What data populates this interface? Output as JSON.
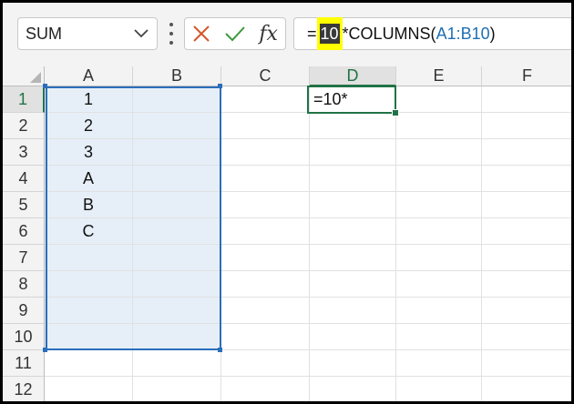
{
  "name_box": {
    "value": "SUM"
  },
  "formula_bar": {
    "prefix": "=",
    "highlighted": "10",
    "middle": "*COLUMNS(",
    "ref": "A1:B10",
    "suffix": ")"
  },
  "columns": [
    "A",
    "B",
    "C",
    "D",
    "E",
    "F"
  ],
  "rows": [
    "1",
    "2",
    "3",
    "4",
    "5",
    "6",
    "7",
    "8",
    "9",
    "10",
    "11",
    "12"
  ],
  "cells": {
    "A1": "1",
    "A2": "2",
    "A3": "3",
    "A4": "A",
    "A5": "B",
    "A6": "C",
    "D1": "=10*"
  },
  "selected_range": "A1:B10",
  "active_cell": "D1",
  "colors": {
    "range_border": "#2a6ebb",
    "range_fill": "#e6eff8",
    "active_green": "#217346",
    "highlight_yellow": "#ffff00",
    "ref_blue": "#1f6fb2"
  },
  "icons": {
    "cancel": "x-icon",
    "enter": "check-icon",
    "function": "fx-icon",
    "dropdown": "chevron-down-icon"
  }
}
